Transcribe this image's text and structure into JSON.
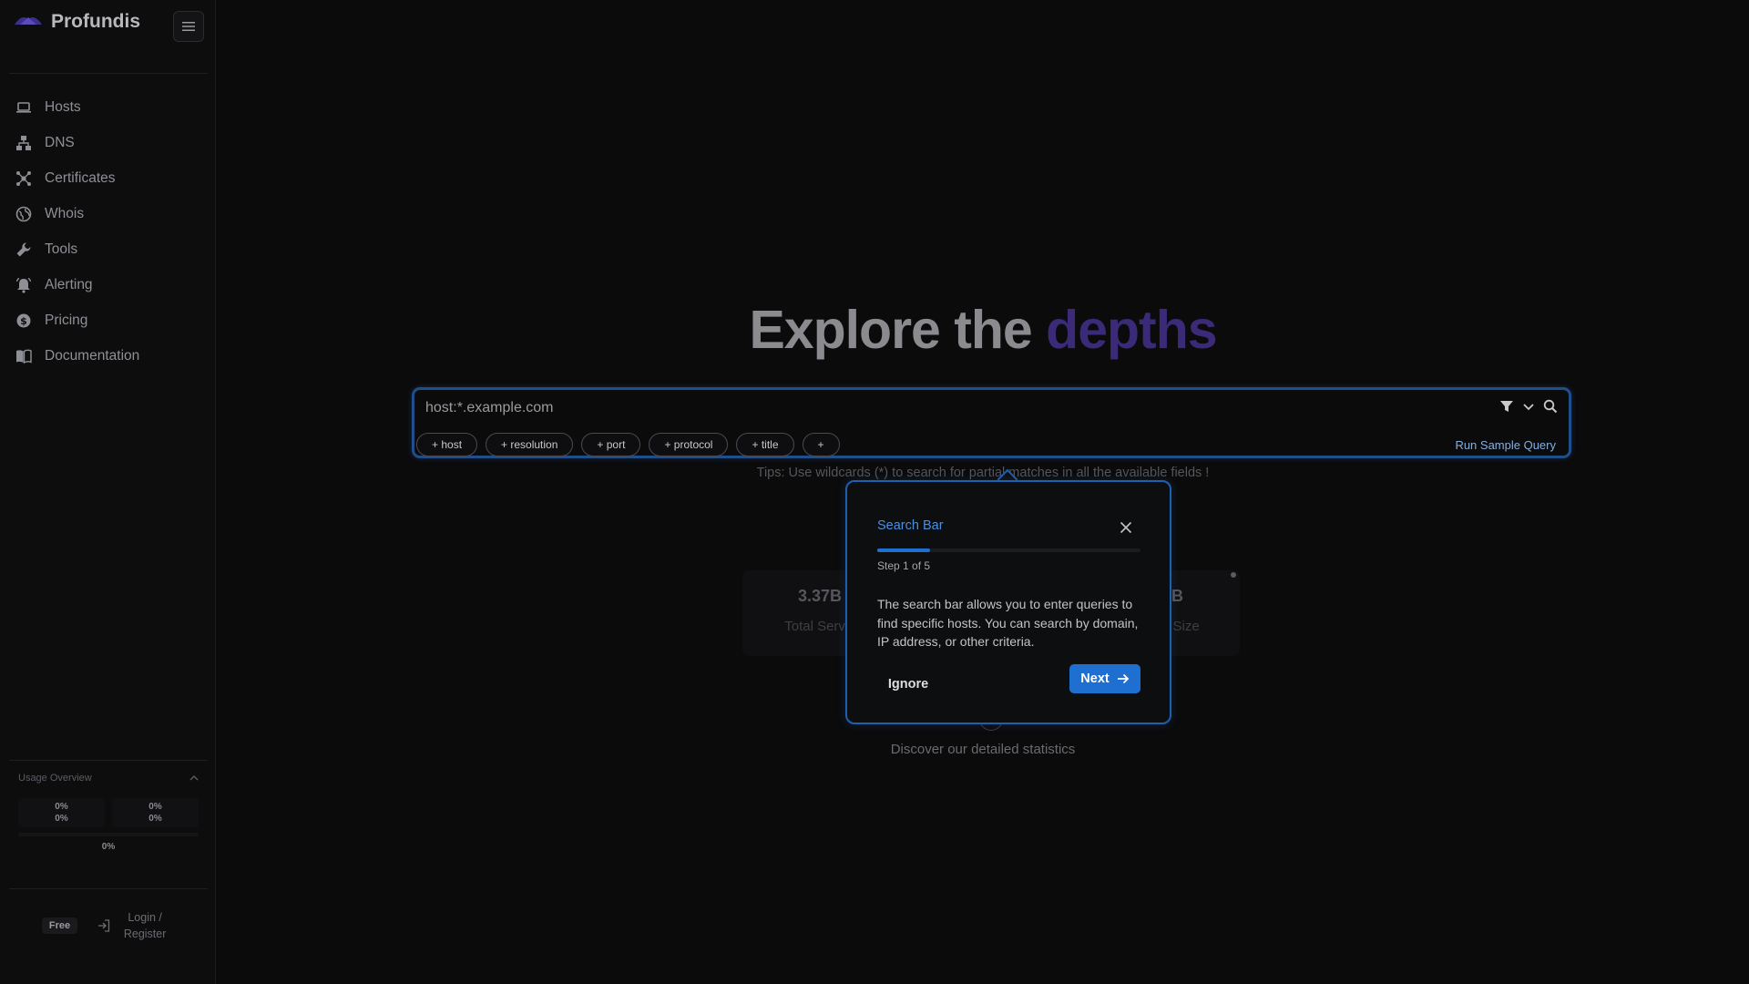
{
  "app": {
    "brand": "Profundis"
  },
  "sidebar": {
    "items": [
      {
        "label": "Hosts",
        "icon": "laptop-icon"
      },
      {
        "label": "DNS",
        "icon": "sitemap-icon"
      },
      {
        "label": "Certificates",
        "icon": "network-icon"
      },
      {
        "label": "Whois",
        "icon": "globe-icon"
      },
      {
        "label": "Tools",
        "icon": "wrench-icon"
      },
      {
        "label": "Alerting",
        "icon": "bell-icon"
      },
      {
        "label": "Pricing",
        "icon": "dollar-icon"
      },
      {
        "label": "Documentation",
        "icon": "book-icon"
      }
    ],
    "usage": {
      "title": "Usage Overview",
      "cells": [
        [
          "0%",
          "0%"
        ],
        [
          "0%",
          "0%"
        ]
      ],
      "total": "0%"
    },
    "footer": {
      "plan": "Free",
      "login": "Login / Register"
    }
  },
  "hero": {
    "title": "Explore the",
    "accent": "depths",
    "accent_color": "#3a2a78"
  },
  "search": {
    "placeholder": "host:*.example.com",
    "chips": [
      "+ host",
      "+ resolution",
      "+ port",
      "+ protocol",
      "+ title",
      "+"
    ],
    "run_sample": "Run Sample Query",
    "tips": "Tips: Use wildcards (*) to search for partial matches in all the available fields !"
  },
  "stats": {
    "left": {
      "value": "3.37B",
      "label": "Total Servic"
    },
    "right": {
      "value": "TB",
      "label": "e Size"
    }
  },
  "discover": "Discover our detailed statistics",
  "tour": {
    "title": "Search Bar",
    "step": "Step 1 of 5",
    "progress": 0.2,
    "body": "The search bar allows you to enter queries to find specific hosts. You can search by domain, IP address, or other criteria.",
    "ignore": "Ignore",
    "next": "Next",
    "accent_color": "#1f6fd1"
  }
}
